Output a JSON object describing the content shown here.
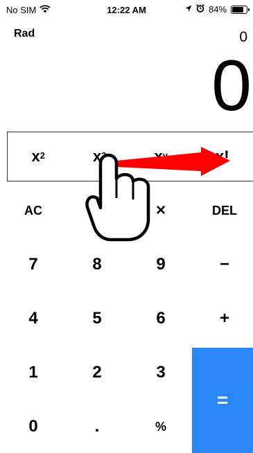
{
  "status_bar": {
    "carrier": "No SIM",
    "time": "12:22 AM",
    "battery": "84%",
    "battery_level": 0.84,
    "icons": [
      "wifi-icon",
      "location-arrow-icon",
      "alarm-icon",
      "battery-icon"
    ]
  },
  "display": {
    "mode": "Rad",
    "expression": "0",
    "result": "0"
  },
  "functions": [
    {
      "base": "x",
      "sup": "2"
    },
    {
      "base": "x",
      "sup": "3"
    },
    {
      "base": "x",
      "sup": "y"
    },
    {
      "base": "x!",
      "sup": ""
    }
  ],
  "keypad": {
    "ac": "AC",
    "minus_top": "−",
    "times": "×",
    "del": "DEL",
    "seven": "7",
    "eight": "8",
    "nine": "9",
    "minus": "−",
    "four": "4",
    "five": "5",
    "six": "6",
    "plus": "+",
    "one": "1",
    "two": "2",
    "three": "3",
    "equals": "=",
    "zero": "0",
    "dot": ".",
    "percent": "%"
  },
  "colors": {
    "equals_bg": "#2a87f7",
    "arrow": "#ff0000"
  },
  "annotation": {
    "gesture": "swipe-right",
    "icons": [
      "hand-pointer-icon",
      "swipe-arrow-icon"
    ]
  }
}
